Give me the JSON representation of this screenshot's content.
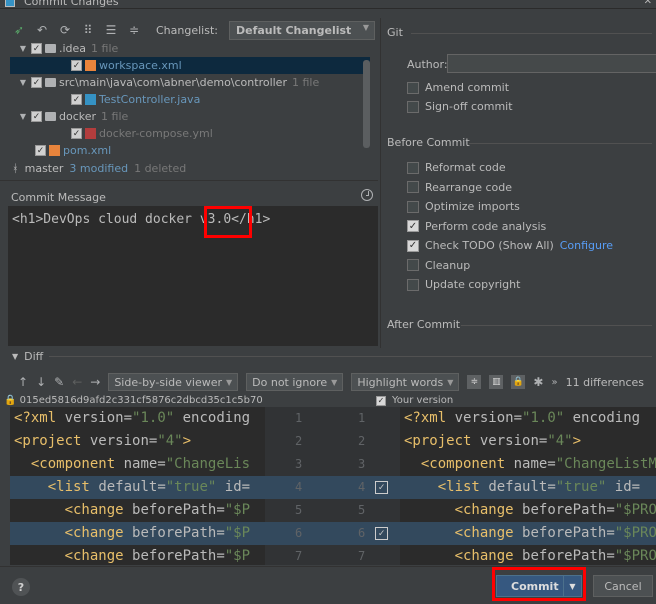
{
  "window": {
    "title": "Commit Changes"
  },
  "changelist": {
    "label": "Changelist:",
    "value": "Default Changelist"
  },
  "tree": [
    {
      "name": ".idea",
      "count": "1 file",
      "kind": "folder",
      "indent": 0
    },
    {
      "name": "workspace.xml",
      "kind": "xml",
      "indent": 1,
      "selected": true
    },
    {
      "name": "src\\main\\java\\com\\abner\\demo\\controller",
      "count": "1 file",
      "kind": "folder",
      "indent": 0
    },
    {
      "name": "TestController.java",
      "kind": "java",
      "indent": 1
    },
    {
      "name": "docker",
      "count": "1 file",
      "kind": "folder",
      "indent": 0
    },
    {
      "name": "docker-compose.yml",
      "kind": "yml",
      "indent": 1
    },
    {
      "name": "pom.xml",
      "kind": "xml",
      "indent": 0
    }
  ],
  "status": {
    "branch": "master",
    "modified": "3 modified",
    "deleted": "1 deleted"
  },
  "commit_message": {
    "label": "Commit Message",
    "text": "<h1>DevOps cloud docker v3.0</h1>"
  },
  "git": {
    "section": "Git",
    "author_label": "Author:",
    "author_value": "",
    "options": [
      {
        "label": "Amend commit",
        "checked": false
      },
      {
        "label": "Sign-off commit",
        "checked": false
      }
    ]
  },
  "before_commit": {
    "section": "Before Commit",
    "options": [
      {
        "label": "Reformat code",
        "checked": false
      },
      {
        "label": "Rearrange code",
        "checked": false
      },
      {
        "label": "Optimize imports",
        "checked": false
      },
      {
        "label": "Perform code analysis",
        "checked": true
      },
      {
        "label": "Check TODO (Show All)",
        "checked": true,
        "link": "Configure"
      },
      {
        "label": "Cleanup",
        "checked": false
      },
      {
        "label": "Update copyright",
        "checked": false
      }
    ]
  },
  "after_commit": {
    "section": "After Commit"
  },
  "diff": {
    "label": "Diff",
    "viewer": "Side-by-side viewer",
    "ignore": "Do not ignore",
    "highlight": "Highlight words",
    "differences": "11 differences",
    "hash": "015ed5816d9afd2c331cf5876c2dbcd35c1c5b70",
    "your_version": "Your version",
    "left_lines": [
      {
        "text": "<?xml version=\"1.0\" encoding",
        "changed": false
      },
      {
        "text": "<project version=\"4\">",
        "changed": false
      },
      {
        "text": "  <component name=\"ChangeLis",
        "changed": false
      },
      {
        "text": "    <list default=\"true\" id=",
        "changed": true
      },
      {
        "text": "      <change beforePath=\"$P",
        "changed": false
      },
      {
        "text": "      <change beforePath=\"$P",
        "changed": true
      },
      {
        "text": "      <change beforePath=\"$P",
        "changed": false
      }
    ],
    "right_lines": [
      {
        "text": "<?xml version=\"1.0\" encoding",
        "changed": false
      },
      {
        "text": "<project version=\"4\">",
        "changed": false
      },
      {
        "text": "  <component name=\"ChangeListM",
        "changed": false
      },
      {
        "text": "    <list default=\"true\" id=",
        "changed": true
      },
      {
        "text": "      <change beforePath=\"$PRO",
        "changed": false
      },
      {
        "text": "      <change beforePath=\"$PRO",
        "changed": true
      },
      {
        "text": "      <change beforePath=\"$PRO",
        "changed": false
      }
    ],
    "gutter": [
      {
        "l": "1",
        "r": "1",
        "changed": false,
        "check": false
      },
      {
        "l": "2",
        "r": "2",
        "changed": false,
        "check": false
      },
      {
        "l": "3",
        "r": "3",
        "changed": false,
        "check": false
      },
      {
        "l": "4",
        "r": "4",
        "changed": true,
        "check": true
      },
      {
        "l": "5",
        "r": "5",
        "changed": false,
        "check": false
      },
      {
        "l": "6",
        "r": "6",
        "changed": true,
        "check": true
      },
      {
        "l": "7",
        "r": "7",
        "changed": false,
        "check": false
      }
    ]
  },
  "buttons": {
    "help": "?",
    "commit": "Commit",
    "cancel": "Cancel"
  },
  "colors": {
    "accent": "#365880",
    "highlight_box": "#ff0000",
    "selection": "#0d293e"
  }
}
